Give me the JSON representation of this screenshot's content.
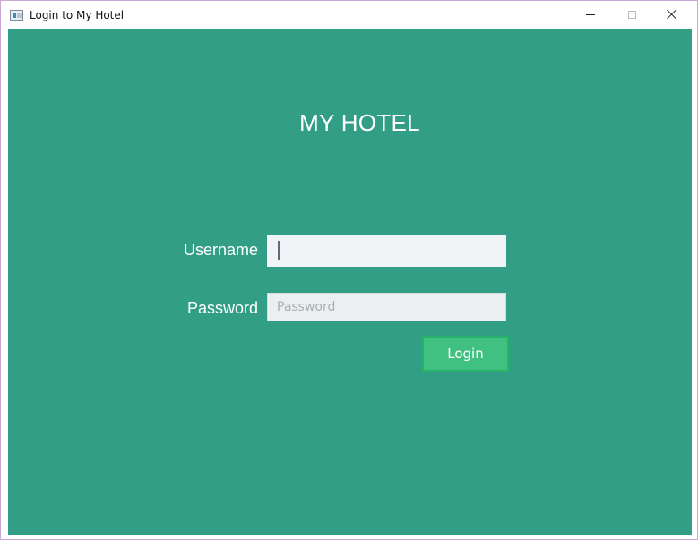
{
  "window": {
    "title": "Login to My Hotel",
    "icon": "app-window-icon",
    "controls": {
      "minimize_icon": "minimize-icon",
      "maximize_icon": "maximize-icon",
      "close_icon": "close-icon"
    }
  },
  "login": {
    "heading": "MY HOTEL",
    "username_label": "Username",
    "username_value": "",
    "username_placeholder": "",
    "password_label": "Password",
    "password_value": "",
    "password_placeholder": "Password",
    "login_button": "Login"
  },
  "colors": {
    "background": "#339e86",
    "button": "#41c181",
    "button_border": "#27b26b",
    "text": "#ffffff"
  }
}
